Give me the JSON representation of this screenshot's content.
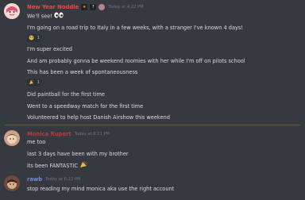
{
  "messages": [
    {
      "username": "New Year Noddle",
      "username_color": "#f04747",
      "badge1": "★",
      "badge2": "?",
      "timestamp": "Today at 4:22 PM",
      "lines": [
        "We'll see!",
        "I'm going on a road trip to Italy in a few weeks, with a stranger I've known 4 days!"
      ],
      "reaction1_count": "1",
      "lines2": [
        "I'm super excited",
        "And am probably gonna be weekend roomies with her while I'm off on pilots school",
        "This has been a week of spontaneousness"
      ],
      "reaction2_count": "1",
      "lines3": [
        "Did paintball for the first time",
        "Went to a speedway match for the first time",
        "Volunteered to help host Danish Airshow this weekend"
      ]
    },
    {
      "username": "Monica Rupert",
      "username_color": "#c0393f",
      "timestamp": "Today at 6:21 PM",
      "lines": [
        "me too",
        "last 3 days have been with my brother",
        "its been FANTASTIC"
      ]
    },
    {
      "username": "rawb",
      "username_color": "#7289da",
      "timestamp": "Today at 6:22 PM",
      "lines": [
        "stop reading my mind monica aka use the right account"
      ]
    }
  ],
  "colors": {
    "background": "#36393f",
    "text": "#dcddde",
    "timestamp": "#72767d",
    "divider": "#a83a3f"
  },
  "icons": [
    "eyes-emoji",
    "reaction-emoji",
    "party-emoji"
  ]
}
